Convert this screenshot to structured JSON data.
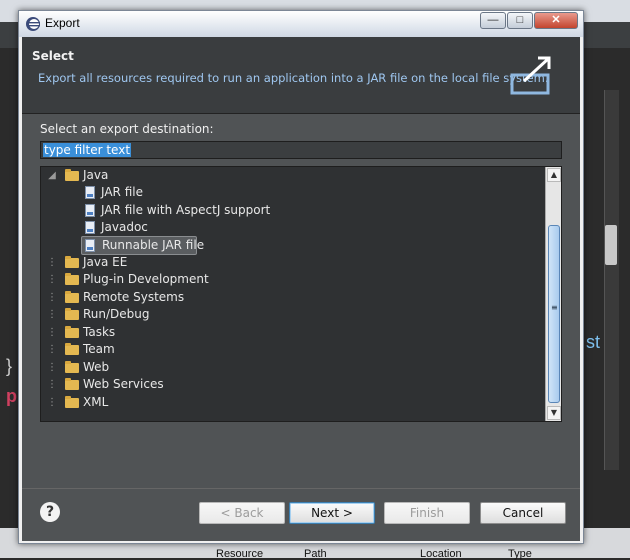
{
  "window": {
    "title": "Export"
  },
  "header": {
    "title": "Select",
    "description": "Export all resources required to run an application into a JAR file on the local file system."
  },
  "content": {
    "prompt_label": "Select an export destination:",
    "filter_value": "type filter text"
  },
  "tree": {
    "items": [
      {
        "label": "Java",
        "type": "folder",
        "expanded": true,
        "level": 0
      },
      {
        "label": "JAR file",
        "type": "file",
        "level": 1
      },
      {
        "label": "JAR file with AspectJ support",
        "type": "file",
        "level": 1
      },
      {
        "label": "Javadoc",
        "type": "file",
        "level": 1
      },
      {
        "label": "Runnable JAR file",
        "type": "file",
        "level": 1,
        "selected": true
      },
      {
        "label": "Java EE",
        "type": "folder",
        "level": 0
      },
      {
        "label": "Plug-in Development",
        "type": "folder",
        "level": 0
      },
      {
        "label": "Remote Systems",
        "type": "folder",
        "level": 0
      },
      {
        "label": "Run/Debug",
        "type": "folder",
        "level": 0
      },
      {
        "label": "Tasks",
        "type": "folder",
        "level": 0
      },
      {
        "label": "Team",
        "type": "folder",
        "level": 0
      },
      {
        "label": "Web",
        "type": "folder",
        "level": 0
      },
      {
        "label": "Web Services",
        "type": "folder",
        "level": 0
      },
      {
        "label": "XML",
        "type": "folder",
        "level": 0
      }
    ]
  },
  "buttons": {
    "back": "< Back",
    "next": "Next >",
    "finish": "Finish",
    "cancel": "Cancel"
  },
  "background": {
    "col_resource": "Resource",
    "col_path": "Path",
    "col_location": "Location",
    "col_type": "Type"
  },
  "colors": {
    "header_bg": "#3a3d3f",
    "description_text": "#9fc7f0",
    "selection": "#3a8fd9"
  }
}
